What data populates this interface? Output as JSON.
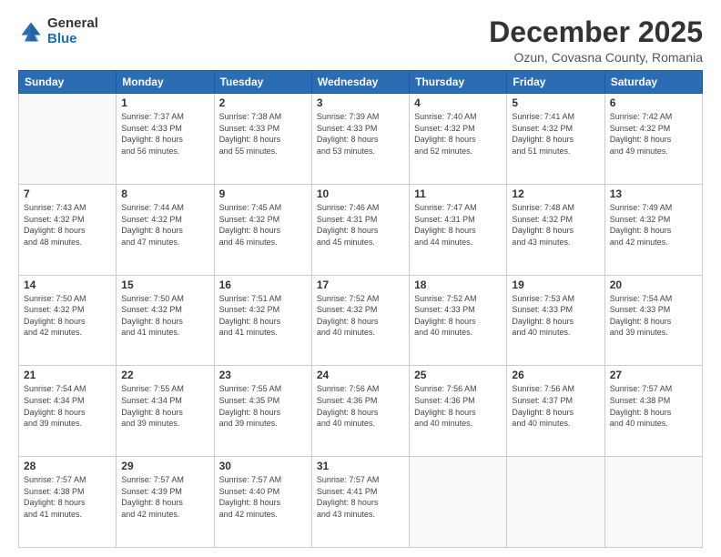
{
  "logo": {
    "general": "General",
    "blue": "Blue"
  },
  "header": {
    "month": "December 2025",
    "location": "Ozun, Covasna County, Romania"
  },
  "weekdays": [
    "Sunday",
    "Monday",
    "Tuesday",
    "Wednesday",
    "Thursday",
    "Friday",
    "Saturday"
  ],
  "weeks": [
    [
      {
        "day": "",
        "info": ""
      },
      {
        "day": "1",
        "info": "Sunrise: 7:37 AM\nSunset: 4:33 PM\nDaylight: 8 hours\nand 56 minutes."
      },
      {
        "day": "2",
        "info": "Sunrise: 7:38 AM\nSunset: 4:33 PM\nDaylight: 8 hours\nand 55 minutes."
      },
      {
        "day": "3",
        "info": "Sunrise: 7:39 AM\nSunset: 4:33 PM\nDaylight: 8 hours\nand 53 minutes."
      },
      {
        "day": "4",
        "info": "Sunrise: 7:40 AM\nSunset: 4:32 PM\nDaylight: 8 hours\nand 52 minutes."
      },
      {
        "day": "5",
        "info": "Sunrise: 7:41 AM\nSunset: 4:32 PM\nDaylight: 8 hours\nand 51 minutes."
      },
      {
        "day": "6",
        "info": "Sunrise: 7:42 AM\nSunset: 4:32 PM\nDaylight: 8 hours\nand 49 minutes."
      }
    ],
    [
      {
        "day": "7",
        "info": "Sunrise: 7:43 AM\nSunset: 4:32 PM\nDaylight: 8 hours\nand 48 minutes."
      },
      {
        "day": "8",
        "info": "Sunrise: 7:44 AM\nSunset: 4:32 PM\nDaylight: 8 hours\nand 47 minutes."
      },
      {
        "day": "9",
        "info": "Sunrise: 7:45 AM\nSunset: 4:32 PM\nDaylight: 8 hours\nand 46 minutes."
      },
      {
        "day": "10",
        "info": "Sunrise: 7:46 AM\nSunset: 4:31 PM\nDaylight: 8 hours\nand 45 minutes."
      },
      {
        "day": "11",
        "info": "Sunrise: 7:47 AM\nSunset: 4:31 PM\nDaylight: 8 hours\nand 44 minutes."
      },
      {
        "day": "12",
        "info": "Sunrise: 7:48 AM\nSunset: 4:32 PM\nDaylight: 8 hours\nand 43 minutes."
      },
      {
        "day": "13",
        "info": "Sunrise: 7:49 AM\nSunset: 4:32 PM\nDaylight: 8 hours\nand 42 minutes."
      }
    ],
    [
      {
        "day": "14",
        "info": "Sunrise: 7:50 AM\nSunset: 4:32 PM\nDaylight: 8 hours\nand 42 minutes."
      },
      {
        "day": "15",
        "info": "Sunrise: 7:50 AM\nSunset: 4:32 PM\nDaylight: 8 hours\nand 41 minutes."
      },
      {
        "day": "16",
        "info": "Sunrise: 7:51 AM\nSunset: 4:32 PM\nDaylight: 8 hours\nand 41 minutes."
      },
      {
        "day": "17",
        "info": "Sunrise: 7:52 AM\nSunset: 4:32 PM\nDaylight: 8 hours\nand 40 minutes."
      },
      {
        "day": "18",
        "info": "Sunrise: 7:52 AM\nSunset: 4:33 PM\nDaylight: 8 hours\nand 40 minutes."
      },
      {
        "day": "19",
        "info": "Sunrise: 7:53 AM\nSunset: 4:33 PM\nDaylight: 8 hours\nand 40 minutes."
      },
      {
        "day": "20",
        "info": "Sunrise: 7:54 AM\nSunset: 4:33 PM\nDaylight: 8 hours\nand 39 minutes."
      }
    ],
    [
      {
        "day": "21",
        "info": "Sunrise: 7:54 AM\nSunset: 4:34 PM\nDaylight: 8 hours\nand 39 minutes."
      },
      {
        "day": "22",
        "info": "Sunrise: 7:55 AM\nSunset: 4:34 PM\nDaylight: 8 hours\nand 39 minutes."
      },
      {
        "day": "23",
        "info": "Sunrise: 7:55 AM\nSunset: 4:35 PM\nDaylight: 8 hours\nand 39 minutes."
      },
      {
        "day": "24",
        "info": "Sunrise: 7:56 AM\nSunset: 4:36 PM\nDaylight: 8 hours\nand 40 minutes."
      },
      {
        "day": "25",
        "info": "Sunrise: 7:56 AM\nSunset: 4:36 PM\nDaylight: 8 hours\nand 40 minutes."
      },
      {
        "day": "26",
        "info": "Sunrise: 7:56 AM\nSunset: 4:37 PM\nDaylight: 8 hours\nand 40 minutes."
      },
      {
        "day": "27",
        "info": "Sunrise: 7:57 AM\nSunset: 4:38 PM\nDaylight: 8 hours\nand 40 minutes."
      }
    ],
    [
      {
        "day": "28",
        "info": "Sunrise: 7:57 AM\nSunset: 4:38 PM\nDaylight: 8 hours\nand 41 minutes."
      },
      {
        "day": "29",
        "info": "Sunrise: 7:57 AM\nSunset: 4:39 PM\nDaylight: 8 hours\nand 42 minutes."
      },
      {
        "day": "30",
        "info": "Sunrise: 7:57 AM\nSunset: 4:40 PM\nDaylight: 8 hours\nand 42 minutes."
      },
      {
        "day": "31",
        "info": "Sunrise: 7:57 AM\nSunset: 4:41 PM\nDaylight: 8 hours\nand 43 minutes."
      },
      {
        "day": "",
        "info": ""
      },
      {
        "day": "",
        "info": ""
      },
      {
        "day": "",
        "info": ""
      }
    ]
  ]
}
